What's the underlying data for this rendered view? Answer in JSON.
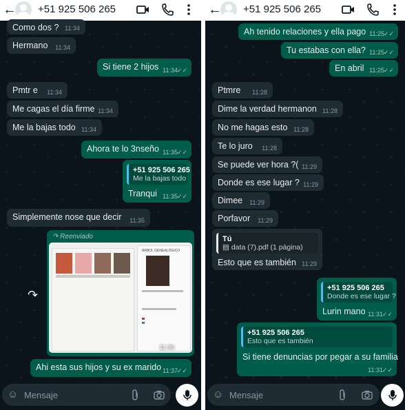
{
  "colors": {
    "incoming": "#202c33",
    "outgoing": "#005c4b",
    "background": "#0b141a",
    "header": "#ffffff",
    "read_tick": "#53bdeb"
  },
  "header": {
    "title": "+51 925 506 265",
    "icons": [
      "back-arrow-icon",
      "avatar",
      "video-call-icon",
      "phone-icon",
      "more-vertical-icon"
    ]
  },
  "input_bar": {
    "placeholder": "Mensaje",
    "icons": [
      "emoji-icon",
      "attach-icon",
      "camera-icon",
      "mic-icon"
    ]
  },
  "left": {
    "messages": [
      {
        "text": "Como dos ?",
        "time": "11:34",
        "dir": "in"
      },
      {
        "text": "Hermano",
        "time": "11:34",
        "dir": "in"
      },
      {
        "text": "Si tiene 2 hijos",
        "time": "11:34",
        "dir": "out"
      },
      {
        "text": "Pmtr e",
        "time": "11:34",
        "dir": "in"
      },
      {
        "text": "Me cagas el día firme",
        "time": "11:34",
        "dir": "in"
      },
      {
        "text": "Me la bajas todo",
        "time": "11:34",
        "dir": "in"
      },
      {
        "text": "Ahora te lo 3nseño",
        "time": "11:35",
        "dir": "out"
      },
      {
        "reply_name": "+51 925 506 265",
        "reply_text": "Me la bajas todo",
        "text": "Tranqui",
        "time": "11:35",
        "dir": "out"
      },
      {
        "text": "Simplemente nose que decir",
        "time": "11:35",
        "dir": "in"
      },
      {
        "forward_label": "Reenviado",
        "time": "11:36",
        "dir": "out",
        "doc_title": "ÁRBOL GENEALÓGICO"
      },
      {
        "text": "Ahi esta sus hijos y su ex marido",
        "time": "11:37",
        "dir": "out"
      }
    ]
  },
  "right": {
    "messages": [
      {
        "text": "Ah tenido relaciones y ella pago",
        "time": "11:25",
        "dir": "out"
      },
      {
        "text": "Tu estabas con ella?",
        "time": "11:25",
        "dir": "out"
      },
      {
        "text": "En abril",
        "time": "11:25",
        "dir": "out"
      },
      {
        "text": "Ptmre",
        "time": "11:28",
        "dir": "in"
      },
      {
        "text": "Dime la verdad hermanon",
        "time": "11:28",
        "dir": "in"
      },
      {
        "text": "No me hagas esto",
        "time": "11:28",
        "dir": "in"
      },
      {
        "text": "Te lo juro",
        "time": "11:28",
        "dir": "in"
      },
      {
        "text": "Se puede ver hora ?(",
        "time": "11:29",
        "dir": "in"
      },
      {
        "text": "Donde es ese lugar ?",
        "time": "11:29",
        "dir": "in"
      },
      {
        "text": "Dimee",
        "time": "11:29",
        "dir": "in"
      },
      {
        "text": "Porfavor",
        "time": "11:29",
        "dir": "in"
      },
      {
        "reply_name": "Tú",
        "reply_text": "data (7).pdf (1 página)",
        "text": "Esto que es también",
        "time": "11:29",
        "dir": "in"
      },
      {
        "reply_name": "+51 925 506 265",
        "reply_text": "Donde es ese lugar ?",
        "text": "Lurin mano",
        "time": "11:31",
        "dir": "out"
      },
      {
        "reply_name": "+51 925 506 265",
        "reply_text": "Esto que es también",
        "text": "Si tiene denuncias por pegar a su familia",
        "time": "11:31",
        "dir": "out"
      }
    ]
  }
}
